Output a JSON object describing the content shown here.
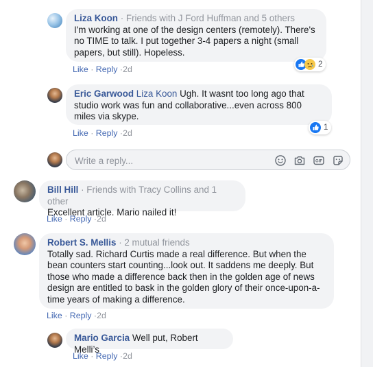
{
  "actions": {
    "like": "Like",
    "reply": "Reply",
    "sep": "·"
  },
  "comments": [
    {
      "author": "Liza Koon",
      "mutual": "· Friends with J Ford Huffman and 5 others",
      "text": "I'm working at one of the design centers (remotely). There's no TIME to talk. I put together 3-4 papers a night (small papers, but still). Hopeless.",
      "time": "2d",
      "reactions": "2"
    },
    {
      "author": "Eric Garwood",
      "tag": "Liza Koon",
      "text": "Ugh. It wasnt too long ago that studio work was fun and collaborative...even across 800 miles via skype.",
      "time": "2d",
      "reactions": "1"
    },
    {
      "author": "Bill Hill",
      "mutual": "· Friends with Tracy Collins and 1 other",
      "text": "Excellent article. Mario nailed it!",
      "time": "2d"
    },
    {
      "author": "Robert S. Mellis",
      "mutual": "· 2 mutual friends",
      "text": "Totally sad. Richard Curtis made a real difference. But when the bean counters start counting...look out. It saddens me deeply. But those who made a difference back then in the golden age of news design are entitled to bask in the golden glory of their once-upon-a-time years of making a difference.",
      "time": "2d"
    },
    {
      "author": "Mario Garcia",
      "text": "Well put, Robert Melli’s",
      "time": "2d"
    }
  ],
  "reply_box": {
    "placeholder": "Write a reply..."
  },
  "colors": {
    "link": "#385898",
    "action": "#4267b2",
    "bubble": "#f2f3f5",
    "like_blue": "#1877f2"
  },
  "icons": [
    "emoji-icon",
    "camera-icon",
    "gif-icon",
    "sticker-icon"
  ]
}
